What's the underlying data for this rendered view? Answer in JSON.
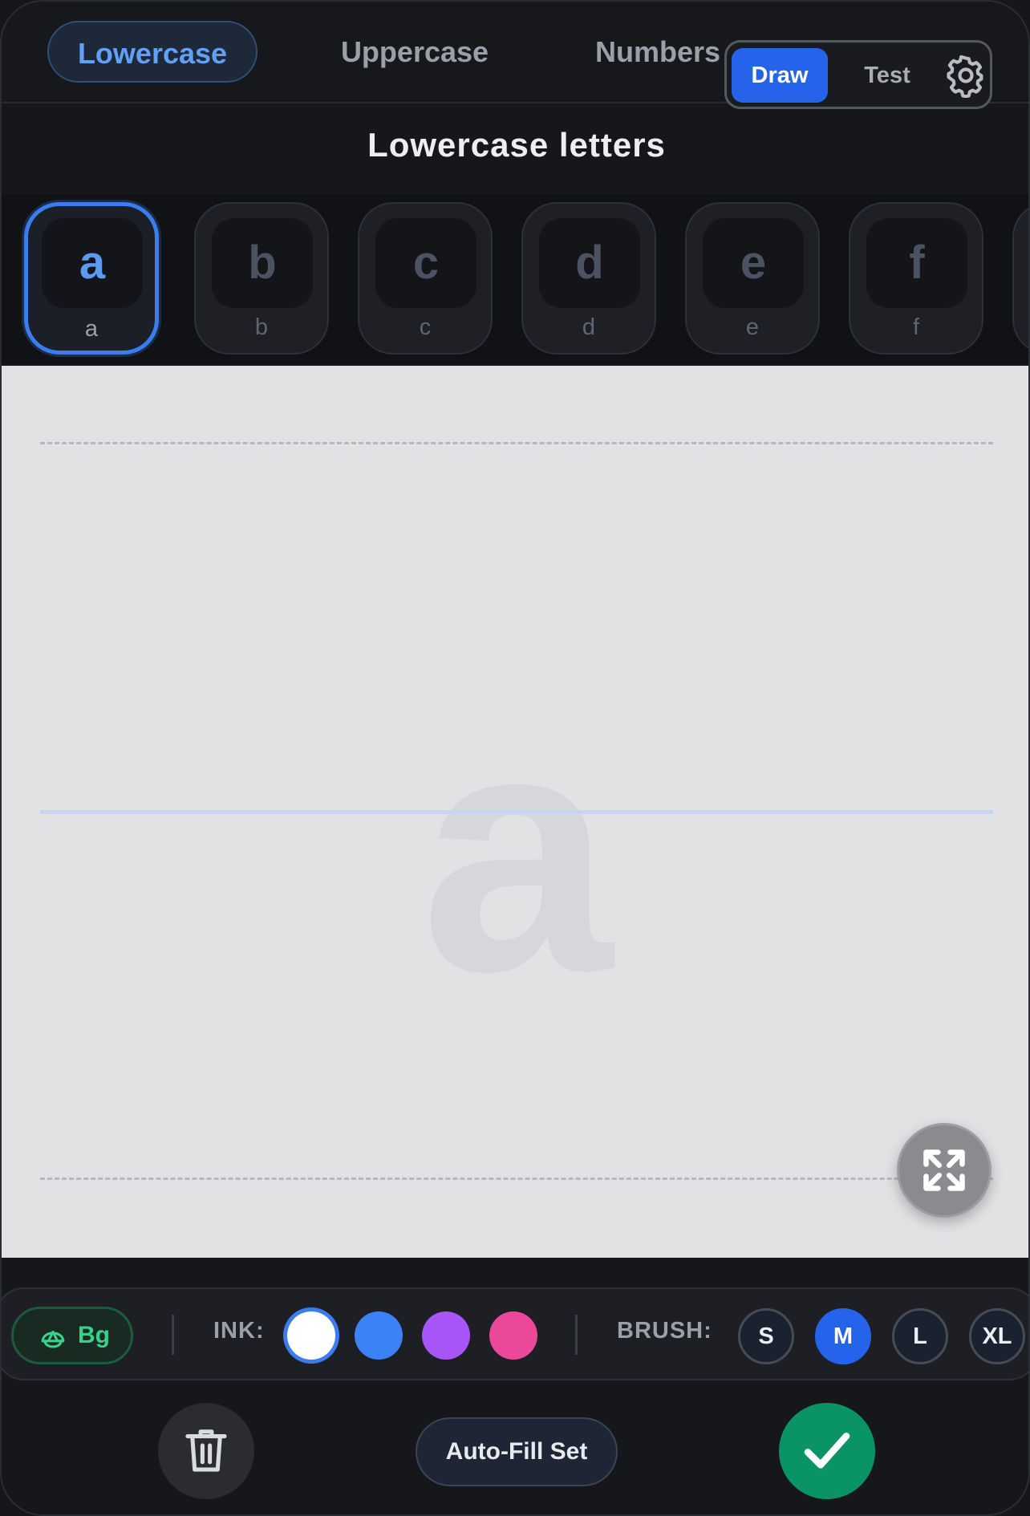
{
  "tabs": [
    {
      "label": "Lowercase",
      "active": true
    },
    {
      "label": "Uppercase",
      "active": false
    },
    {
      "label": "Numbers",
      "active": false
    }
  ],
  "mode": {
    "draw_label": "Draw",
    "test_label": "Test",
    "active": "Draw",
    "settings_icon": "gear-icon"
  },
  "section_title": "Lowercase letters",
  "letters": [
    {
      "glyph": "a",
      "caption": "a",
      "selected": true
    },
    {
      "glyph": "b",
      "caption": "b",
      "selected": false
    },
    {
      "glyph": "c",
      "caption": "c",
      "selected": false
    },
    {
      "glyph": "d",
      "caption": "d",
      "selected": false
    },
    {
      "glyph": "e",
      "caption": "e",
      "selected": false
    },
    {
      "glyph": "f",
      "caption": "f",
      "selected": false
    }
  ],
  "canvas": {
    "ghost_letter": "a",
    "fullscreen_icon": "expand-icon"
  },
  "toolbar": {
    "bg_label": "Bg",
    "bg_icon": "paint-bucket-icon",
    "ink_label": "INK:",
    "ink_colors": [
      "#ffffff",
      "#3b82f6",
      "#a855f7",
      "#ec4899"
    ],
    "ink_selected": "#ffffff",
    "brush_label": "BRUSH:",
    "brush_sizes": [
      "S",
      "M",
      "L",
      "XL"
    ],
    "brush_selected": "M"
  },
  "actions": {
    "delete_icon": "trash-icon",
    "autofill_label": "Auto-Fill Set",
    "confirm_icon": "check-icon"
  },
  "colors": {
    "accent": "#2563eb",
    "confirm": "#0a9466",
    "bg_green": "#3ad08a"
  }
}
